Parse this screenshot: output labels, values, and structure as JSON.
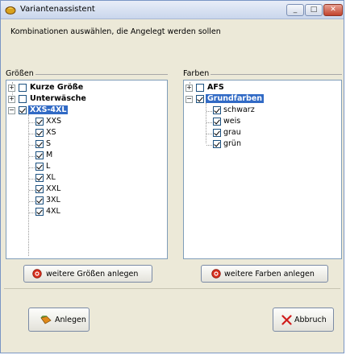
{
  "window": {
    "title": "Variantenassistent"
  },
  "instruction": "Kombinationen auswählen, die Angelegt werden sollen",
  "sizes_group": {
    "label": "Größen",
    "nodes": [
      {
        "label": "Kurze Größe",
        "checked": false,
        "expander": "+"
      },
      {
        "label": "Unterwäsche",
        "checked": false,
        "expander": "+"
      },
      {
        "label": "XXS-4XL",
        "checked": true,
        "expander": "-",
        "selected": true
      }
    ],
    "children": [
      {
        "label": "XXS",
        "checked": true
      },
      {
        "label": "XS",
        "checked": true
      },
      {
        "label": "S",
        "checked": true
      },
      {
        "label": "M",
        "checked": true
      },
      {
        "label": "L",
        "checked": true
      },
      {
        "label": "XL",
        "checked": true
      },
      {
        "label": "XXL",
        "checked": true
      },
      {
        "label": "3XL",
        "checked": true
      },
      {
        "label": "4XL",
        "checked": true
      }
    ],
    "button": "weitere Größen anlegen"
  },
  "colors_group": {
    "label": "Farben",
    "nodes": [
      {
        "label": "AFS",
        "checked": false,
        "expander": "+"
      },
      {
        "label": "Grundfarben",
        "checked": true,
        "expander": "-",
        "selected": true
      }
    ],
    "children": [
      {
        "label": "schwarz",
        "checked": true
      },
      {
        "label": "weis",
        "checked": true
      },
      {
        "label": "grau",
        "checked": true
      },
      {
        "label": "grün",
        "checked": true
      }
    ],
    "button": "weitere Farben anlegen"
  },
  "footer": {
    "create_button": "Anlegen",
    "cancel_button": "Abbruch"
  },
  "colors": {
    "selection": "#316ac5",
    "add_icon": "#d9301f",
    "cancel_icon": "#d01c1c",
    "create_icon": "#e0891a"
  }
}
